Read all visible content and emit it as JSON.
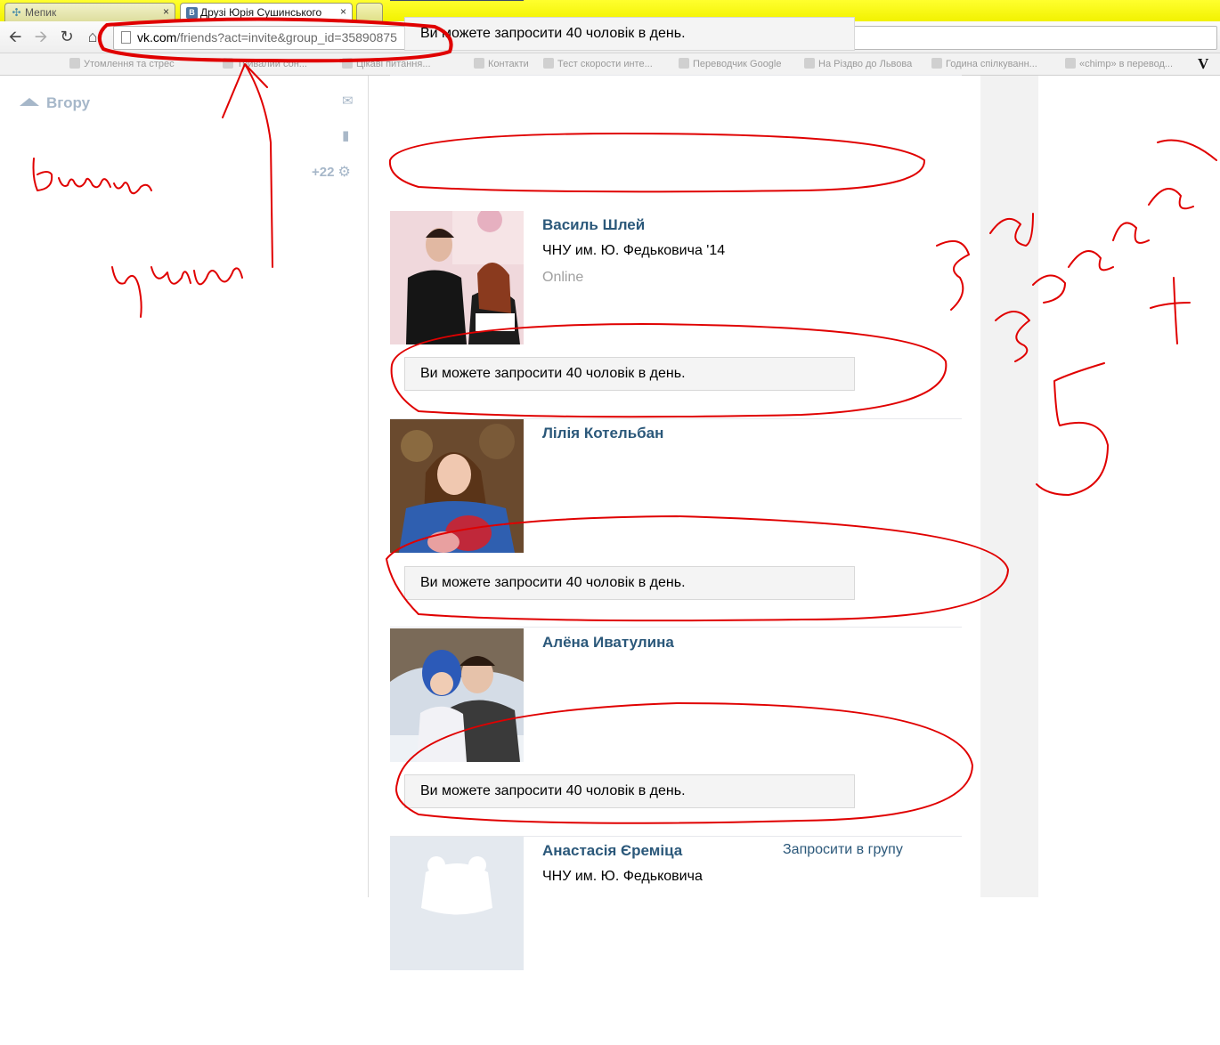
{
  "browser": {
    "tabs": [
      {
        "title": "Мепик",
        "close": "×"
      },
      {
        "title": "Друзі Юрія Сушинського",
        "close": "×"
      }
    ],
    "url_host": "vk.com",
    "url_path": "/friends?act=invite&group_id=35890875",
    "bookmarks": [
      "Утомлення та стрес",
      "Тривалий сон...",
      "Цікаві питання...",
      "Контакти",
      "Тест скорости инте...",
      "Переводчик Google",
      "На Різдво до Львова",
      "Година спілкуванн...",
      "«chimp» в перевод..."
    ],
    "bookmark_extra": "V"
  },
  "sidebar": {
    "up_label": "Вгору",
    "counter": "+22"
  },
  "limit_text": "Ви можете запросити 40 чоловік в день.",
  "friends": [
    {
      "name": "Василь Шлей",
      "line1": "ЧНУ им. Ю. Федьковича '14",
      "line2": "Online"
    },
    {
      "name": "Лілія Котельбан"
    },
    {
      "name": "Алёна Ивату­лина"
    },
    {
      "name": "Анастасія Єреміца",
      "line1": "ЧНУ им. Ю. Федьковича",
      "action": "Запросити в групу"
    }
  ],
  "colors": {
    "link": "#2b587a",
    "annotation": "#e00000"
  }
}
